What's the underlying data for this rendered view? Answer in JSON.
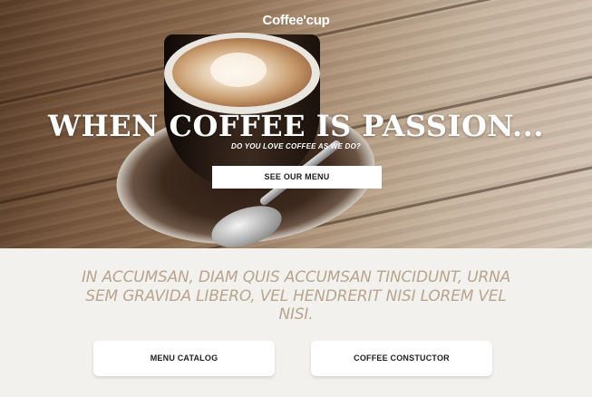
{
  "brand": {
    "logo": "Coffee'cup"
  },
  "hero": {
    "headline": "WHEN COFFEE IS PASSION...",
    "subline": "DO YOU LOVE COFFEE AS WE DO?",
    "cta_label": "SEE OUR MENU",
    "image": "coffee-cup-on-wooden-table"
  },
  "intro": {
    "tagline": "IN ACCUMSAN, DIAM QUIS ACCUMSAN TINCIDUNT, URNA SEM GRAVIDA LIBERO, VEL HENDRERIT NISI LOREM VEL NISI."
  },
  "actions": {
    "menu_catalog_label": "MENU CATALOG",
    "coffee_constructor_label": "COFFEE CONSTUCTOR"
  },
  "colors": {
    "page_background": "#f3f1ee",
    "tagline": "#b7a58e",
    "button_background": "#ffffff",
    "button_text": "#1e1e1e",
    "hero_text": "#ffffff"
  }
}
